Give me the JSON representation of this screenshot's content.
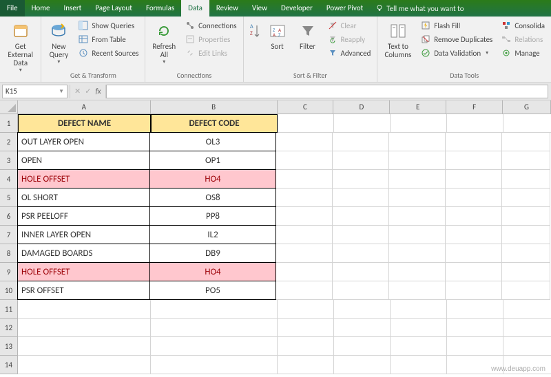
{
  "menubar": {
    "tabs": [
      "File",
      "Home",
      "Insert",
      "Page Layout",
      "Formulas",
      "Data",
      "Review",
      "View",
      "Developer",
      "Power Pivot"
    ],
    "active": "Data",
    "tell_me": "Tell me what you want to"
  },
  "ribbon": {
    "groups": {
      "get_transform": {
        "label": "Get & Transform",
        "get_external": "Get External\nData",
        "new_query": "New\nQuery",
        "show_queries": "Show Queries",
        "from_table": "From Table",
        "recent_sources": "Recent Sources"
      },
      "connections": {
        "label": "Connections",
        "refresh_all": "Refresh\nAll",
        "connections": "Connections",
        "properties": "Properties",
        "edit_links": "Edit Links"
      },
      "sort_filter": {
        "label": "Sort & Filter",
        "sort": "Sort",
        "filter": "Filter",
        "clear": "Clear",
        "reapply": "Reapply",
        "advanced": "Advanced"
      },
      "data_tools": {
        "label": "Data Tools",
        "text_to_columns": "Text to\nColumns",
        "flash_fill": "Flash Fill",
        "remove_dupes": "Remove Duplicates",
        "data_validation": "Data Validation",
        "consolidate": "Consolida",
        "relationships": "Relations",
        "manage": "Manage"
      }
    }
  },
  "namebox": "K15",
  "columns": [
    "A",
    "B",
    "C",
    "D",
    "E",
    "F",
    "G"
  ],
  "rows": [
    "1",
    "2",
    "3",
    "4",
    "5",
    "6",
    "7",
    "8",
    "9",
    "10",
    "11",
    "12",
    "13",
    "14"
  ],
  "table": {
    "header": {
      "name": "DEFECT NAME",
      "code": "DEFECT CODE"
    },
    "rows": [
      {
        "name": "OUT LAYER OPEN",
        "code": "OL3",
        "dup": false
      },
      {
        "name": "OPEN",
        "code": "OP1",
        "dup": false
      },
      {
        "name": "HOLE OFFSET",
        "code": "HO4",
        "dup": true
      },
      {
        "name": "OL SHORT",
        "code": "OS8",
        "dup": false
      },
      {
        "name": "PSR PEELOFF",
        "code": "PP8",
        "dup": false
      },
      {
        "name": "INNER LAYER OPEN",
        "code": "IL2",
        "dup": false
      },
      {
        "name": "DAMAGED BOARDS",
        "code": "DB9",
        "dup": false
      },
      {
        "name": "HOLE OFFSET",
        "code": "HO4",
        "dup": true
      },
      {
        "name": "PSR OFFSET",
        "code": "PO5",
        "dup": false
      }
    ]
  },
  "watermark": "www.deuapp.com"
}
